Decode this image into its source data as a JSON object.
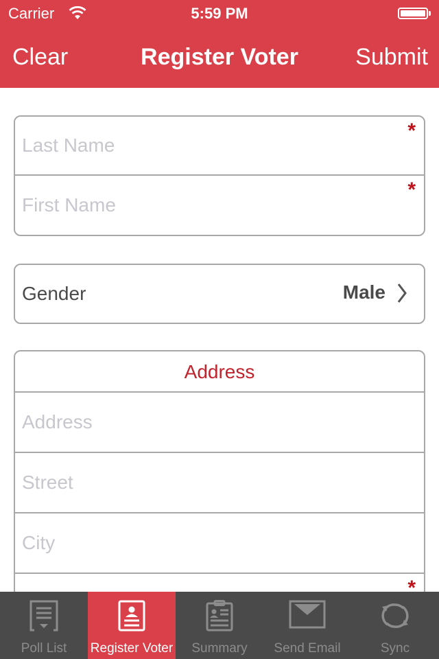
{
  "status_bar": {
    "carrier": "Carrier",
    "time": "5:59 PM",
    "battery_level": 1.0
  },
  "nav": {
    "left_button": "Clear",
    "title": "Register Voter",
    "right_button": "Submit"
  },
  "name_fields": [
    {
      "placeholder": "Last Name",
      "value": "",
      "required": true,
      "required_mark": "*"
    },
    {
      "placeholder": "First Name",
      "value": "",
      "required": true,
      "required_mark": "*"
    }
  ],
  "gender": {
    "label": "Gender",
    "value": "Male"
  },
  "address": {
    "header": "Address",
    "fields": [
      {
        "placeholder": "Address",
        "value": ""
      },
      {
        "placeholder": "Street",
        "value": ""
      },
      {
        "placeholder": "City",
        "value": ""
      },
      {
        "placeholder": "",
        "value": "",
        "required": true,
        "required_mark": "*"
      }
    ]
  },
  "tabs": [
    {
      "label": "Poll List",
      "icon": "poll-list-icon",
      "active": false
    },
    {
      "label": "Register Voter",
      "icon": "register-voter-icon",
      "active": true
    },
    {
      "label": "Summary",
      "icon": "summary-clipboard-icon",
      "active": false
    },
    {
      "label": "Send Email",
      "icon": "envelope-icon",
      "active": false
    },
    {
      "label": "Sync",
      "icon": "sync-icon",
      "active": false
    }
  ],
  "colors": {
    "accent": "#d9404a",
    "tab_bar": "#4a4a4a",
    "required": "#c0111b",
    "section_header": "#c0252e",
    "placeholder": "#c7c7cd",
    "border": "#a8a8a8"
  }
}
